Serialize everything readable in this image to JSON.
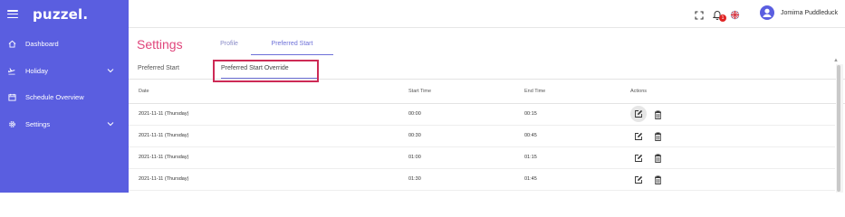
{
  "app": {
    "logo": "puzzel."
  },
  "sidebar": {
    "items": [
      {
        "label": "Dashboard",
        "icon": "home-icon",
        "has_chevron": false
      },
      {
        "label": "Holiday",
        "icon": "plane-icon",
        "has_chevron": true
      },
      {
        "label": "Schedule Overview",
        "icon": "calendar-icon",
        "has_chevron": false
      },
      {
        "label": "Settings",
        "icon": "gear-icon",
        "has_chevron": true
      }
    ]
  },
  "topbar": {
    "notification_count": "1",
    "user_name": "Jomima Puddleduck"
  },
  "page": {
    "title": "Settings",
    "tabs": [
      {
        "label": "Profile",
        "active": false
      },
      {
        "label": "Preferred Start",
        "active": true
      }
    ],
    "subtabs": [
      {
        "label": "Preferred Start",
        "active": false
      },
      {
        "label": "Preferred Start Override",
        "active": true
      }
    ]
  },
  "table": {
    "headers": {
      "date": "Date",
      "start": "Start Time",
      "end": "End Time",
      "actions": "Actions"
    },
    "rows": [
      {
        "date": "2021-11-11 (Thursday)",
        "start": "00:00",
        "end": "00:15"
      },
      {
        "date": "2021-11-11 (Thursday)",
        "start": "00:30",
        "end": "00:45"
      },
      {
        "date": "2021-11-11 (Thursday)",
        "start": "01:00",
        "end": "01:15"
      },
      {
        "date": "2021-11-11 (Thursday)",
        "start": "01:30",
        "end": "01:45"
      }
    ]
  },
  "colors": {
    "sidebar_bg": "#5a5ee0",
    "accent": "#6d70d8",
    "title_pink": "#e0457b",
    "highlight_border": "#cd2a55"
  }
}
